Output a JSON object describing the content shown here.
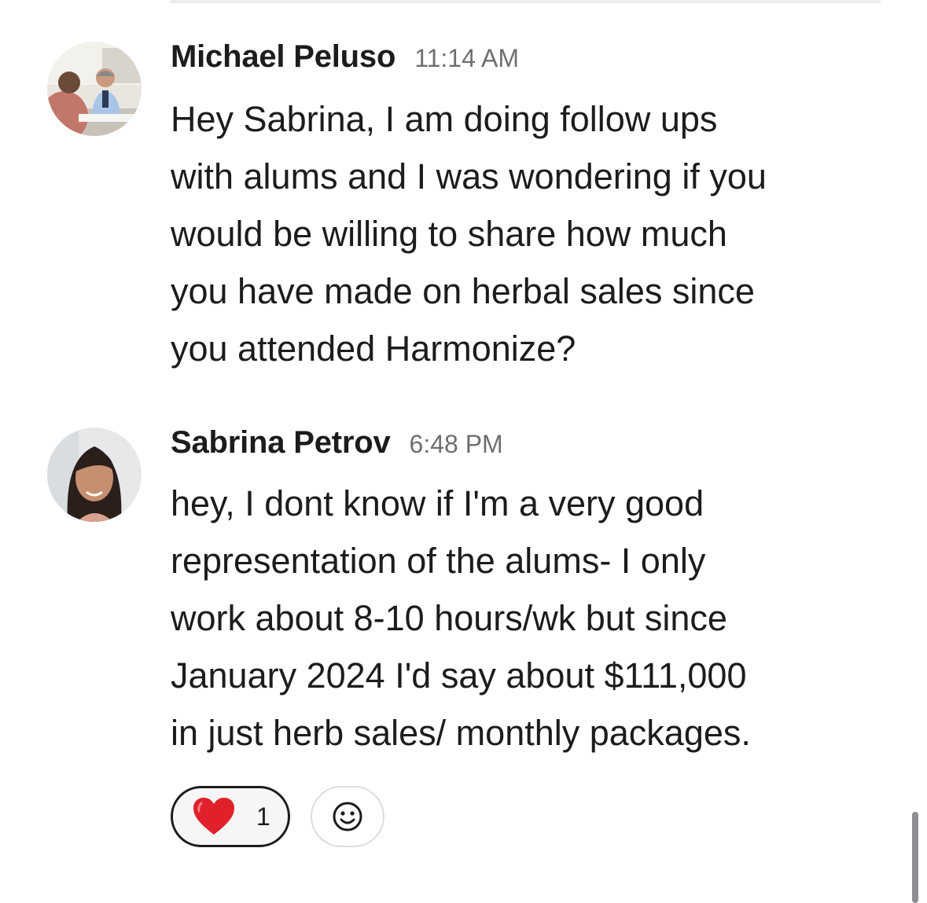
{
  "messages": [
    {
      "author": "Michael Peluso",
      "time": "11:14 AM",
      "lines": [
        "Hey Sabrina, I am doing follow ups",
        "with alums and I was wondering if you",
        "would be willing to share how much",
        "you have made on herbal sales since",
        "you attended Harmonize?"
      ]
    },
    {
      "author": "Sabrina Petrov",
      "time": "6:48 PM",
      "lines": [
        "hey, I dont know if I'm a very good",
        "representation of the alums- I only",
        "work about 8-10 hours/wk but since",
        "January 2024 I'd say about $111,000",
        "in just herb sales/ monthly packages."
      ]
    }
  ],
  "reactions": [
    {
      "emoji": "heart-icon",
      "count": "1"
    }
  ],
  "add_reaction_icon": "smiley-icon",
  "colors": {
    "text": "#1d1c1d",
    "timestamp": "#6f6f72",
    "heart": "#e0202a",
    "pill_border": "#1d1c1d",
    "add_reaction_border": "#dcdcdc"
  }
}
